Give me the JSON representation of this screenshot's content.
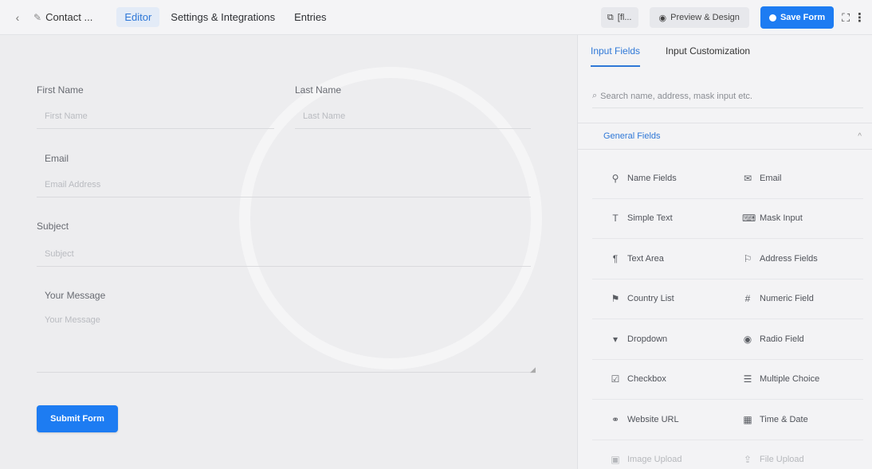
{
  "topbar": {
    "back_icon": "chevron-left-icon",
    "form_title": "Contact ...",
    "nav": [
      "Editor",
      "Settings & Integrations",
      "Entries"
    ],
    "active_nav": "Editor",
    "shortcode_label": "[fl...",
    "preview_label": "Preview & Design",
    "save_label": "Save Form",
    "accent": "#1d7cf2"
  },
  "form": {
    "first_name": {
      "label": "First Name",
      "placeholder": "First Name"
    },
    "last_name": {
      "label": "Last Name",
      "placeholder": "Last Name"
    },
    "email": {
      "label": "Email",
      "placeholder": "Email Address"
    },
    "subject": {
      "label": "Subject",
      "placeholder": "Subject"
    },
    "message": {
      "label": "Your Message",
      "placeholder": "Your Message"
    },
    "submit_label": "Submit Form"
  },
  "panel": {
    "tabs": [
      "Input Fields",
      "Input Customization"
    ],
    "active_tab": "Input Fields",
    "search_placeholder": "Search name, address, mask input etc.",
    "section_title": "General Fields",
    "fields": [
      {
        "label": "Name Fields",
        "icon": "user-icon",
        "glyph": "⚲"
      },
      {
        "label": "Email",
        "icon": "envelope-icon",
        "glyph": "✉"
      },
      {
        "label": "Simple Text",
        "icon": "text-cursor-icon",
        "glyph": "T"
      },
      {
        "label": "Mask Input",
        "icon": "keyboard-icon",
        "glyph": "⌨"
      },
      {
        "label": "Text Area",
        "icon": "paragraph-icon",
        "glyph": "¶"
      },
      {
        "label": "Address Fields",
        "icon": "location-pin-icon",
        "glyph": "⚐"
      },
      {
        "label": "Country List",
        "icon": "flag-icon",
        "glyph": "⚑"
      },
      {
        "label": "Numeric Field",
        "icon": "hash-icon",
        "glyph": "#"
      },
      {
        "label": "Dropdown",
        "icon": "dropdown-icon",
        "glyph": "▾"
      },
      {
        "label": "Radio Field",
        "icon": "radio-icon",
        "glyph": "◉"
      },
      {
        "label": "Checkbox",
        "icon": "checkbox-icon",
        "glyph": "☑"
      },
      {
        "label": "Multiple Choice",
        "icon": "list-icon",
        "glyph": "☰"
      },
      {
        "label": "Website URL",
        "icon": "link-icon",
        "glyph": "⚭"
      },
      {
        "label": "Time & Date",
        "icon": "calendar-icon",
        "glyph": "▦"
      },
      {
        "label": "Image Upload",
        "icon": "image-icon",
        "glyph": "▣"
      },
      {
        "label": "File Upload",
        "icon": "upload-icon",
        "glyph": "⇪"
      }
    ]
  }
}
